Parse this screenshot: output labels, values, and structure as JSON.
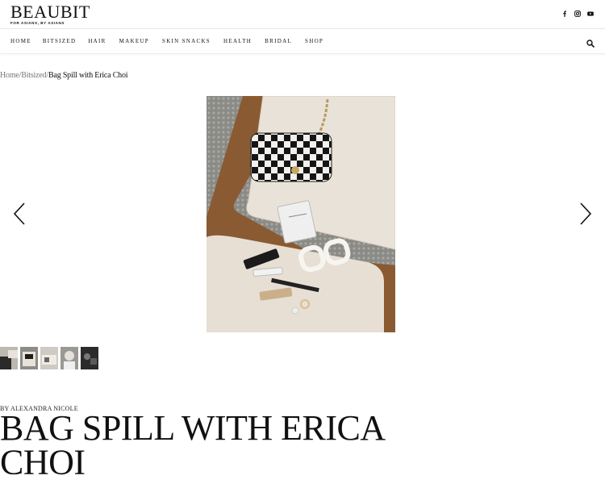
{
  "brand": {
    "name": "BEAUBIT",
    "tagline": "FOR ASIANS, BY ASIANS"
  },
  "social": [
    {
      "icon": "facebook-icon",
      "glyph": "f"
    },
    {
      "icon": "instagram-icon"
    },
    {
      "icon": "youtube-icon"
    }
  ],
  "nav": {
    "items": [
      "HOME",
      "BITSIZED",
      "HAIR",
      "MAKEUP",
      "SKIN SNACKS",
      "HEALTH",
      "BRIDAL",
      "SHOP"
    ],
    "search_icon": "search-icon"
  },
  "breadcrumb": {
    "home": "Home",
    "section": "Bitsized",
    "current": "Bag Spill with Erica Choi",
    "separator": "/"
  },
  "gallery": {
    "prev_icon": "chevron-left-icon",
    "next_icon": "chevron-right-icon",
    "thumbnail_count": 5
  },
  "article": {
    "byline": "BY ALEXANDRA NICOLE",
    "title": "BAG SPILL WITH ERICA CHOI"
  },
  "colors": {
    "text": "#111111",
    "muted": "#777777",
    "divider": "#e6e6e6"
  }
}
